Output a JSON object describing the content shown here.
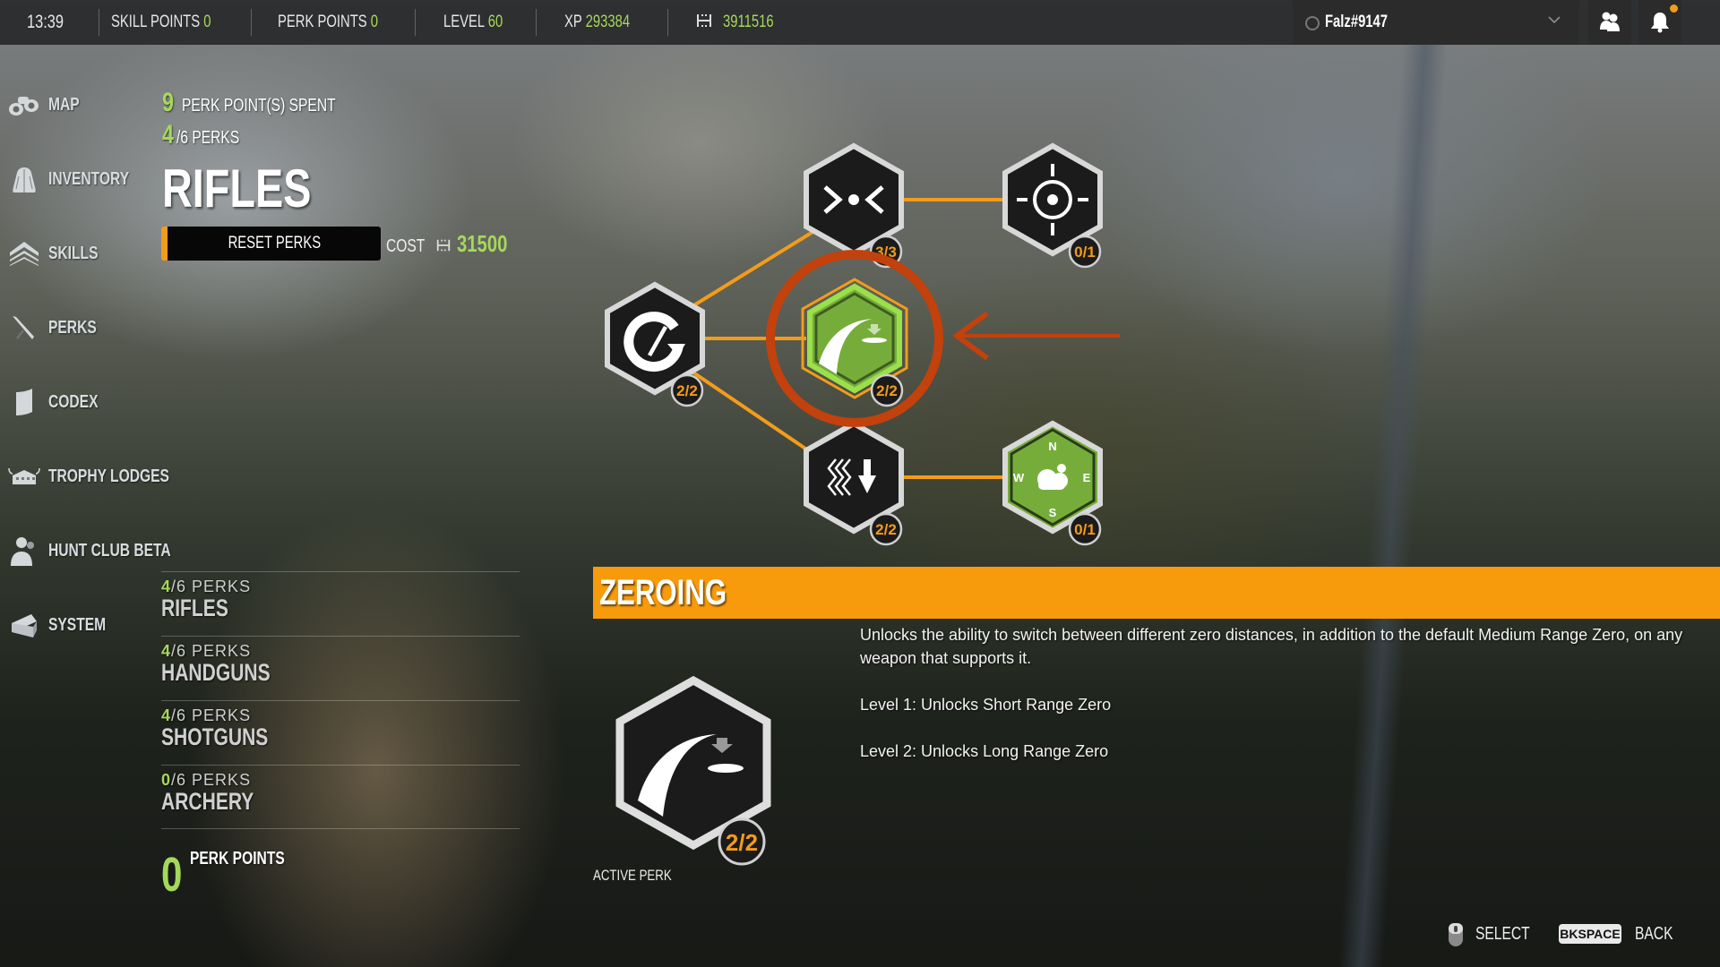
{
  "topbar": {
    "clock": "13:39",
    "skill_points_label": "SKILL POINTS",
    "skill_points_value": "0",
    "perk_points_label": "PERK POINTS",
    "perk_points_value": "0",
    "level_label": "LEVEL",
    "level_value": "60",
    "xp_label": "XP",
    "xp_value": "293384",
    "currency_icon": "gm-dollar-icon",
    "currency_value": "3911516",
    "username": "Falz#9147",
    "status": "offline",
    "icons": [
      "friends-icon",
      "bell-icon"
    ],
    "has_notification": true
  },
  "nav": {
    "items": [
      {
        "label": "MAP",
        "icon": "binoculars-icon"
      },
      {
        "label": "INVENTORY",
        "icon": "backpack-icon"
      },
      {
        "label": "SKILLS",
        "icon": "chevrons-up-icon"
      },
      {
        "label": "PERKS",
        "icon": "knife-icon"
      },
      {
        "label": "CODEX",
        "icon": "book-icon"
      },
      {
        "label": "TROPHY LODGES",
        "icon": "lodge-icon"
      },
      {
        "label": "HUNT CLUB BETA",
        "icon": "hunter-icon"
      },
      {
        "label": "SYSTEM",
        "icon": "toolbox-icon"
      }
    ]
  },
  "header": {
    "points_spent": "9",
    "points_spent_label": "PERK POINT(S) SPENT",
    "perks_unlocked": "4",
    "perks_total_label": "/6 PERKS",
    "category_title": "RIFLES",
    "reset_label": "RESET PERKS",
    "cost_label": "COST",
    "cost_value": "31500"
  },
  "categories": [
    {
      "unlocked": "4",
      "total": "/6",
      "perks_label": "PERKS",
      "name": "RIFLES"
    },
    {
      "unlocked": "4",
      "total": "/6",
      "perks_label": "PERKS",
      "name": "HANDGUNS"
    },
    {
      "unlocked": "4",
      "total": "/6",
      "perks_label": "PERKS",
      "name": "SHOTGUNS"
    },
    {
      "unlocked": "0",
      "total": "/6",
      "perks_label": "PERKS",
      "name": "ARCHERY"
    }
  ],
  "perk_points": {
    "value": "0",
    "label": "PERK POINTS"
  },
  "tree": {
    "nodes": [
      {
        "id": "reload",
        "icon": "reload-bullet-icon",
        "level": "2/2",
        "state": "unlocked"
      },
      {
        "id": "marksman",
        "icon": "converge-dot-icon",
        "level": "3/3",
        "state": "unlocked"
      },
      {
        "id": "sight",
        "icon": "crosshair-icon",
        "level": "0/1",
        "state": "locked"
      },
      {
        "id": "zeroing",
        "icon": "bullet-drop-icon",
        "level": "2/2",
        "state": "selected"
      },
      {
        "id": "recoil",
        "icon": "heat-drop-icon",
        "level": "2/2",
        "state": "unlocked"
      },
      {
        "id": "wind",
        "icon": "compass-weather-icon",
        "level": "0/1",
        "state": "available"
      }
    ],
    "compass_letters": [
      "N",
      "E",
      "S",
      "W"
    ],
    "accent": "#f39c1a",
    "selected_green": "#7cb63b",
    "highlight_ring": "#c2410c"
  },
  "detail": {
    "title": "ZEROING",
    "description": "Unlocks the ability to switch between different zero distances, in addition to the default Medium Range Zero, on any weapon that supports it.",
    "level1": "Level 1: Unlocks Short Range Zero",
    "level2": "Level 2: Unlocks Long Range Zero",
    "level": "2/2",
    "active_label": "ACTIVE PERK"
  },
  "footer": {
    "select_label": "SELECT",
    "back_key": "BKSPACE",
    "back_label": "BACK"
  }
}
